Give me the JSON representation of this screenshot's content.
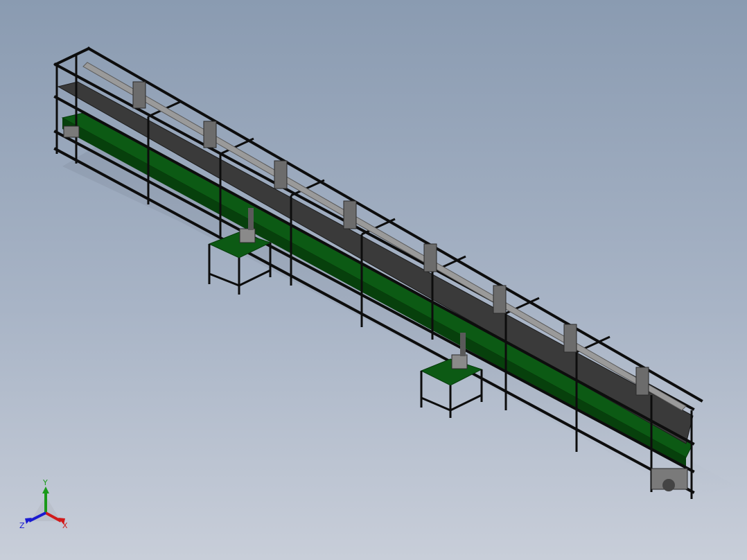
{
  "triad": {
    "x_label": "X",
    "y_label": "Y",
    "z_label": "Z",
    "x_color": "#d11a1a",
    "y_color": "#1a9a1a",
    "z_color": "#1a1ad1"
  },
  "colors": {
    "frame": "#0d0d0d",
    "conveyor_belt": "#0c5a14",
    "conveyor_dark": "#07400c",
    "top_shelf": "#3a3a3a",
    "background_top": "#8a9bb1",
    "background_bottom": "#c8ced9"
  }
}
